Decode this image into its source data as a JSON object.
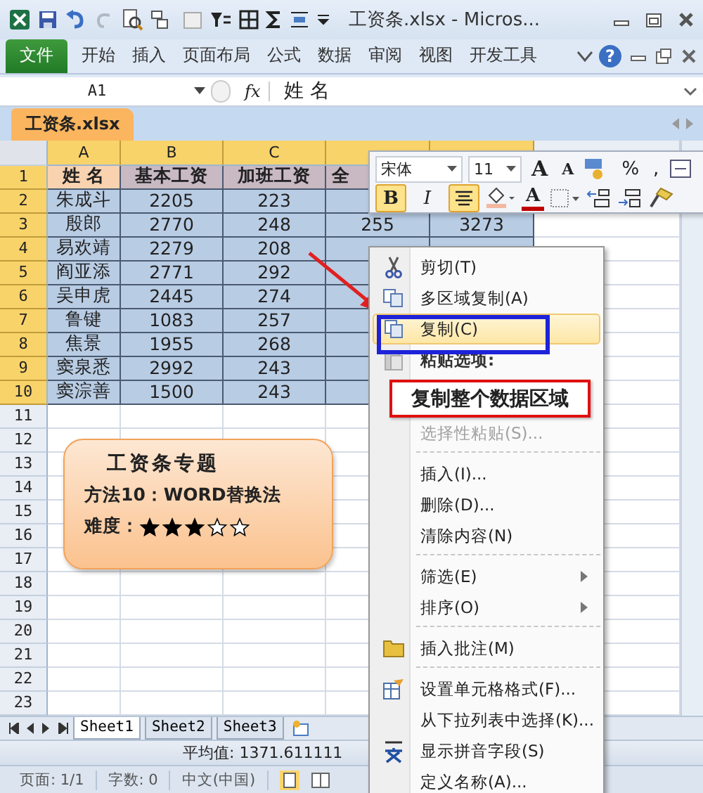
{
  "title_bar": {
    "title": "工资条.xlsx - Micros..."
  },
  "ribbon": {
    "tabs": [
      {
        "label": "文件",
        "kind": "file"
      },
      {
        "label": "开始",
        "kind": "tab"
      },
      {
        "label": "插入",
        "kind": "tab"
      },
      {
        "label": "页面布局",
        "kind": "tab"
      },
      {
        "label": "公式",
        "kind": "tab"
      },
      {
        "label": "数据",
        "kind": "tab"
      },
      {
        "label": "审阅",
        "kind": "tab"
      },
      {
        "label": "视图",
        "kind": "tab"
      },
      {
        "label": "开发工具",
        "kind": "tab"
      }
    ],
    "help": "?"
  },
  "formula_bar": {
    "name_box": "A1",
    "fx": "fx",
    "value": "姓 名"
  },
  "workbook_tab": "工资条.xlsx",
  "columns": [
    {
      "label": "A",
      "selected": true
    },
    {
      "label": "B",
      "selected": true
    },
    {
      "label": "C",
      "selected": true
    },
    {
      "selected": true
    },
    {
      "selected": true
    }
  ],
  "rows": [
    {
      "number": "1",
      "selected": true,
      "kind": "header",
      "cells": [
        "姓 名",
        "基本工资",
        "加班工资",
        "全"
      ]
    },
    {
      "number": "2",
      "selected": true,
      "kind": "data",
      "cells": [
        "朱成斗",
        "2205",
        "223"
      ]
    },
    {
      "number": "3",
      "selected": true,
      "kind": "data",
      "cells": [
        "殷郎",
        "2770",
        "248",
        "255",
        "3273"
      ]
    },
    {
      "number": "4",
      "selected": true,
      "kind": "data",
      "cells": [
        "易欢靖",
        "2279",
        "208"
      ]
    },
    {
      "number": "5",
      "selected": true,
      "kind": "data",
      "cells": [
        "阎亚添",
        "2771",
        "292"
      ]
    },
    {
      "number": "6",
      "selected": true,
      "kind": "data",
      "cells": [
        "吴申虎",
        "2445",
        "274"
      ]
    },
    {
      "number": "7",
      "selected": true,
      "kind": "data",
      "cells": [
        "鲁键",
        "1083",
        "257"
      ]
    },
    {
      "number": "8",
      "selected": true,
      "kind": "data",
      "cells": [
        "焦景",
        "1955",
        "268"
      ]
    },
    {
      "number": "9",
      "selected": true,
      "kind": "data",
      "cells": [
        "窦泉悉",
        "2992",
        "243"
      ]
    },
    {
      "number": "10",
      "selected": true,
      "kind": "data",
      "cells": [
        "窦淙善",
        "1500",
        "243"
      ]
    },
    {
      "number": "11",
      "selected": false
    },
    {
      "number": "12",
      "selected": false
    },
    {
      "number": "13",
      "selected": false
    },
    {
      "number": "14",
      "selected": false
    },
    {
      "number": "15",
      "selected": false
    },
    {
      "number": "16",
      "selected": false
    },
    {
      "number": "17",
      "selected": false
    },
    {
      "number": "18",
      "selected": false
    },
    {
      "number": "19",
      "selected": false
    },
    {
      "number": "20",
      "selected": false
    },
    {
      "number": "21",
      "selected": false
    },
    {
      "number": "22",
      "selected": false
    },
    {
      "number": "23",
      "selected": false
    }
  ],
  "mini_toolbar": {
    "font": "宋体",
    "size": "11",
    "grow": "A",
    "shrink": "A",
    "percent": "%",
    "comma": ",",
    "buttons": [
      {
        "kind": "bold",
        "label": "B",
        "selected": true
      },
      {
        "kind": "italic",
        "label": "I",
        "selected": false
      },
      {
        "kind": "center",
        "selected": true
      },
      {
        "kind": "fill"
      },
      {
        "kind": "font_color",
        "label": "A"
      },
      {
        "kind": "border"
      },
      {
        "kind": "inc_decimal"
      },
      {
        "kind": "dec_decimal"
      },
      {
        "kind": "painter"
      }
    ]
  },
  "context_menu": [
    {
      "label": "剪切(T)",
      "kind": "item",
      "selected": false,
      "disabled": false
    },
    {
      "label": "多区域复制(A)",
      "kind": "item",
      "selected": false,
      "disabled": false
    },
    {
      "label": "复制(C)",
      "kind": "item",
      "selected": true,
      "disabled": false
    },
    {
      "label": "粘贴选项:",
      "kind": "header"
    },
    {
      "kind": "paste_row"
    },
    {
      "label": "选择性粘贴(S)...",
      "kind": "item",
      "selected": false,
      "disabled": true
    },
    {
      "label": "插入(I)...",
      "kind": "item",
      "selected": false,
      "disabled": false,
      "divider_before": true
    },
    {
      "label": "删除(D)...",
      "kind": "item",
      "selected": false,
      "disabled": false
    },
    {
      "label": "清除内容(N)",
      "kind": "item",
      "selected": false,
      "disabled": false
    },
    {
      "label": "筛选(E)",
      "kind": "submenu",
      "selected": false,
      "disabled": false,
      "divider_before": true
    },
    {
      "label": "排序(O)",
      "kind": "submenu",
      "selected": false,
      "disabled": false
    },
    {
      "label": "插入批注(M)",
      "kind": "item",
      "selected": false,
      "disabled": false,
      "divider_before": true
    },
    {
      "label": "设置单元格格式(F)...",
      "kind": "item",
      "selected": false,
      "disabled": false,
      "divider_before": true
    },
    {
      "label": "从下拉列表中选择(K)...",
      "kind": "item",
      "selected": false,
      "disabled": false
    },
    {
      "label": "显示拼音字段(S)",
      "kind": "item",
      "selected": false,
      "disabled": false
    },
    {
      "label": "定义名称(A)...",
      "kind": "item",
      "selected": false,
      "disabled": false
    }
  ],
  "annotation": "复制整个数据区域",
  "callout": {
    "title": "工资条专题",
    "method": "方法10：WORD替换法",
    "difficulty_label": "难度：",
    "stars": 3
  },
  "sheet_tabs": [
    {
      "label": "Sheet1",
      "selected": true
    },
    {
      "label": "Sheet2",
      "selected": false
    },
    {
      "label": "Sheet3",
      "selected": false
    }
  ],
  "status_bar": {
    "average": "平均值: 1371.611111"
  },
  "word_status_bar": [
    "页面: 1/1",
    "字数: 0",
    "中文(中国)"
  ]
}
